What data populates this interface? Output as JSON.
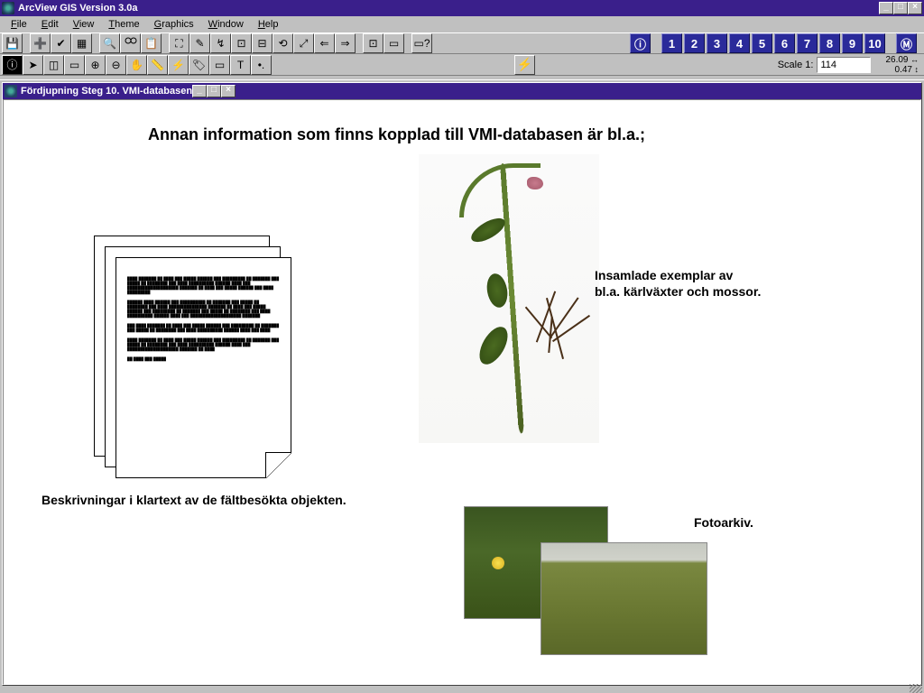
{
  "app": {
    "title": "ArcView GIS Version 3.0a"
  },
  "menus": {
    "file": "File",
    "edit": "Edit",
    "view": "View",
    "theme": "Theme",
    "graphics": "Graphics",
    "window": "Window",
    "help": "Help"
  },
  "window_controls": {
    "min": "_",
    "max": "□",
    "close": "×"
  },
  "num_buttons": {
    "info": "ⓘ",
    "items": [
      "1",
      "2",
      "3",
      "4",
      "5",
      "6",
      "7",
      "8",
      "9",
      "10"
    ],
    "m": "Ⓜ"
  },
  "scale": {
    "label": "Scale 1:",
    "value": "114"
  },
  "coords": {
    "x": "26.09",
    "y": "0.47"
  },
  "inner_window": {
    "title": "Fördjupning Steg 10. VMI-databasen",
    "min": "_",
    "max": "□",
    "close": "×"
  },
  "content": {
    "heading": "Annan information som finns kopplad till VMI-databasen är bl.a.;",
    "left_caption": "Beskrivningar i klartext av de fältbesökta objekten.",
    "right_caption_1": "Insamlade exemplar av",
    "right_caption_2": "bl.a. kärlväxter och mossor.",
    "photo_caption": "Fotoarkiv."
  },
  "tools_row1": [
    "save-icon",
    "add-theme-icon",
    "theme-props-icon",
    "table-icon",
    "find-icon",
    "locate-icon",
    "query-icon",
    "zoom-full-icon",
    "zoom-active-icon",
    "zoom-sel-icon",
    "zoom-in-icon",
    "zoom-out-icon",
    "zoom-prev-icon",
    "sel-features-icon",
    "clear-sel-icon",
    "pan-tool-icon",
    "measure-icon",
    "hotlink-icon",
    "help-pointer-icon"
  ],
  "tools_row2": [
    "identify-icon",
    "pointer-icon",
    "vertex-icon",
    "select-rect-icon",
    "zoom-in2-icon",
    "zoom-out2-icon",
    "pan-icon",
    "measure2-icon",
    "hotlink2-icon",
    "label-icon",
    "text-tool-icon",
    "draw-point-icon"
  ]
}
